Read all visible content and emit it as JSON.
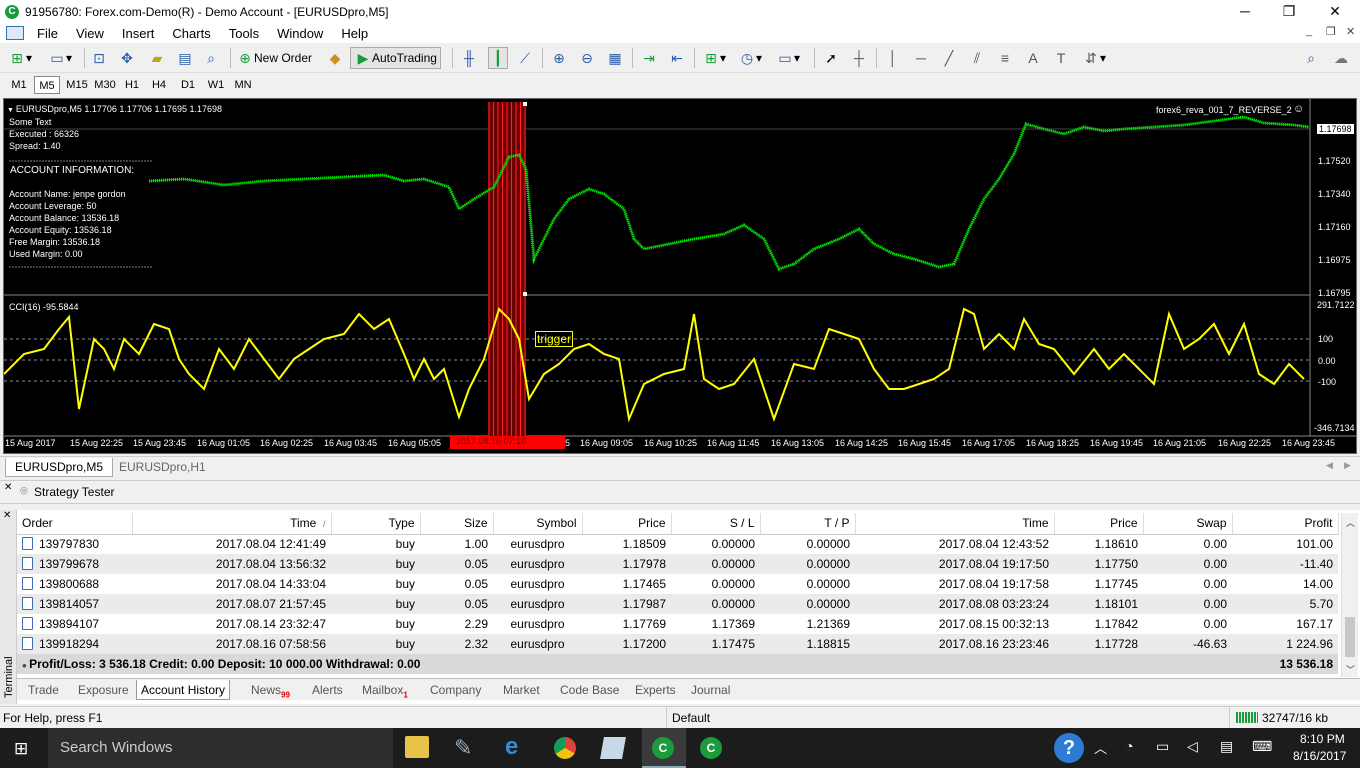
{
  "window": {
    "title": "91956780: Forex.com-Demo(R) - Demo Account - [EURUSDpro,M5]",
    "controls": [
      "─",
      "❐",
      "✕"
    ]
  },
  "menu": [
    "File",
    "View",
    "Insert",
    "Charts",
    "Tools",
    "Window",
    "Help"
  ],
  "toolbar": {
    "new_order": "New Order",
    "autotrading": "AutoTrading"
  },
  "periods": [
    "M1",
    "M5",
    "M15",
    "M30",
    "H1",
    "H4",
    "D1",
    "W1",
    "MN"
  ],
  "active_period": "M5",
  "chart": {
    "header": "EURUSDpro,M5  1.17706 1.17706 1.17695 1.17698",
    "expert": "forex6_reva_001_7_REVERSE_2",
    "info": {
      "line1": "Some Text",
      "line2": "Executed : 66326",
      "line3": "Spread: 1.40",
      "section": "ACCOUNT INFORMATION:",
      "name": "Account Name:   jenpe gordon",
      "leverage": "Account Leverage:     50",
      "balance": "Account Balance:     13536.18",
      "equity": "Account Equity:       13536.18",
      "free": "Free Margin:     13536.18",
      "used": "Used Margin:       0.00"
    },
    "price_axis": [
      "1.17698",
      "1.17520",
      "1.17340",
      "1.17160",
      "1.16975",
      "1.16795"
    ],
    "cci_label": "CCI(16) -95.5844",
    "cci_axis": [
      "291.7122",
      "100",
      "0.00",
      "-100",
      "-346.7134"
    ],
    "trigger": "trigger",
    "time_axis": [
      "15 Aug 2017",
      "15 Aug 22:25",
      "15 Aug 23:45",
      "16 Aug 01:05",
      "16 Aug 02:25",
      "16 Aug 03:45",
      "16 Aug 05:05",
      "16 Aug 09:05",
      "16 Aug 10:25",
      "16 Aug 11:45",
      "16 Aug 13:05",
      "16 Aug 14:25",
      "16 Aug 15:45",
      "16 Aug 17:05",
      "16 Aug 18:25",
      "16 Aug 19:45",
      "16 Aug 21:05",
      "16 Aug 22:25",
      "16 Aug 23:45"
    ],
    "time_marker": "2017.08.16 07:10",
    "colors": {
      "candles": "#00ff00",
      "cci": "#ffff00",
      "marker": "#ff0000"
    }
  },
  "chart_tabs": [
    "EURUSDpro,M5",
    "EURUSDpro,H1"
  ],
  "tester": "Strategy Tester",
  "history": {
    "columns": [
      "Order",
      "Time",
      "Type",
      "Size",
      "Symbol",
      "Price",
      "S / L",
      "T / P",
      "Time",
      "Price",
      "Swap",
      "Profit"
    ],
    "sort_mark": "/",
    "rows": [
      [
        "139797830",
        "2017.08.04 12:41:49",
        "buy",
        "1.00",
        "eurusdpro",
        "1.18509",
        "0.00000",
        "0.00000",
        "2017.08.04 12:43:52",
        "1.18610",
        "0.00",
        "101.00"
      ],
      [
        "139799678",
        "2017.08.04 13:56:32",
        "buy",
        "0.05",
        "eurusdpro",
        "1.17978",
        "0.00000",
        "0.00000",
        "2017.08.04 19:17:50",
        "1.17750",
        "0.00",
        "-11.40"
      ],
      [
        "139800688",
        "2017.08.04 14:33:04",
        "buy",
        "0.05",
        "eurusdpro",
        "1.17465",
        "0.00000",
        "0.00000",
        "2017.08.04 19:17:58",
        "1.17745",
        "0.00",
        "14.00"
      ],
      [
        "139814057",
        "2017.08.07 21:57:45",
        "buy",
        "0.05",
        "eurusdpro",
        "1.17987",
        "0.00000",
        "0.00000",
        "2017.08.08 03:23:24",
        "1.18101",
        "0.00",
        "5.70"
      ],
      [
        "139894107",
        "2017.08.14 23:32:47",
        "buy",
        "2.29",
        "eurusdpro",
        "1.17769",
        "1.17369",
        "1.21369",
        "2017.08.15 00:32:13",
        "1.17842",
        "0.00",
        "167.17"
      ],
      [
        "139918294",
        "2017.08.16 07:58:56",
        "buy",
        "2.32",
        "eurusdpro",
        "1.17200",
        "1.17475",
        "1.18815",
        "2017.08.16 23:23:46",
        "1.17728",
        "-46.63",
        "1 224.96"
      ]
    ],
    "summary": "Profit/Loss: 3 536.18  Credit: 0.00  Deposit: 10 000.00  Withdrawal: 0.00",
    "summary_total": "13 536.18"
  },
  "terminal_label": "Terminal",
  "terminal_tabs": [
    {
      "label": "Trade",
      "badge": ""
    },
    {
      "label": "Exposure",
      "badge": ""
    },
    {
      "label": "Account History",
      "badge": ""
    },
    {
      "label": "News",
      "badge": "99"
    },
    {
      "label": "Alerts",
      "badge": ""
    },
    {
      "label": "Mailbox",
      "badge": "1"
    },
    {
      "label": "Company",
      "badge": ""
    },
    {
      "label": "Market",
      "badge": ""
    },
    {
      "label": "Code Base",
      "badge": ""
    },
    {
      "label": "Experts",
      "badge": ""
    },
    {
      "label": "Journal",
      "badge": ""
    }
  ],
  "status": {
    "help": "For Help, press F1",
    "profile": "Default",
    "traffic": "32747/16 kb"
  },
  "taskbar": {
    "search": "Search Windows",
    "time": "8:10 PM",
    "date": "8/16/2017"
  }
}
